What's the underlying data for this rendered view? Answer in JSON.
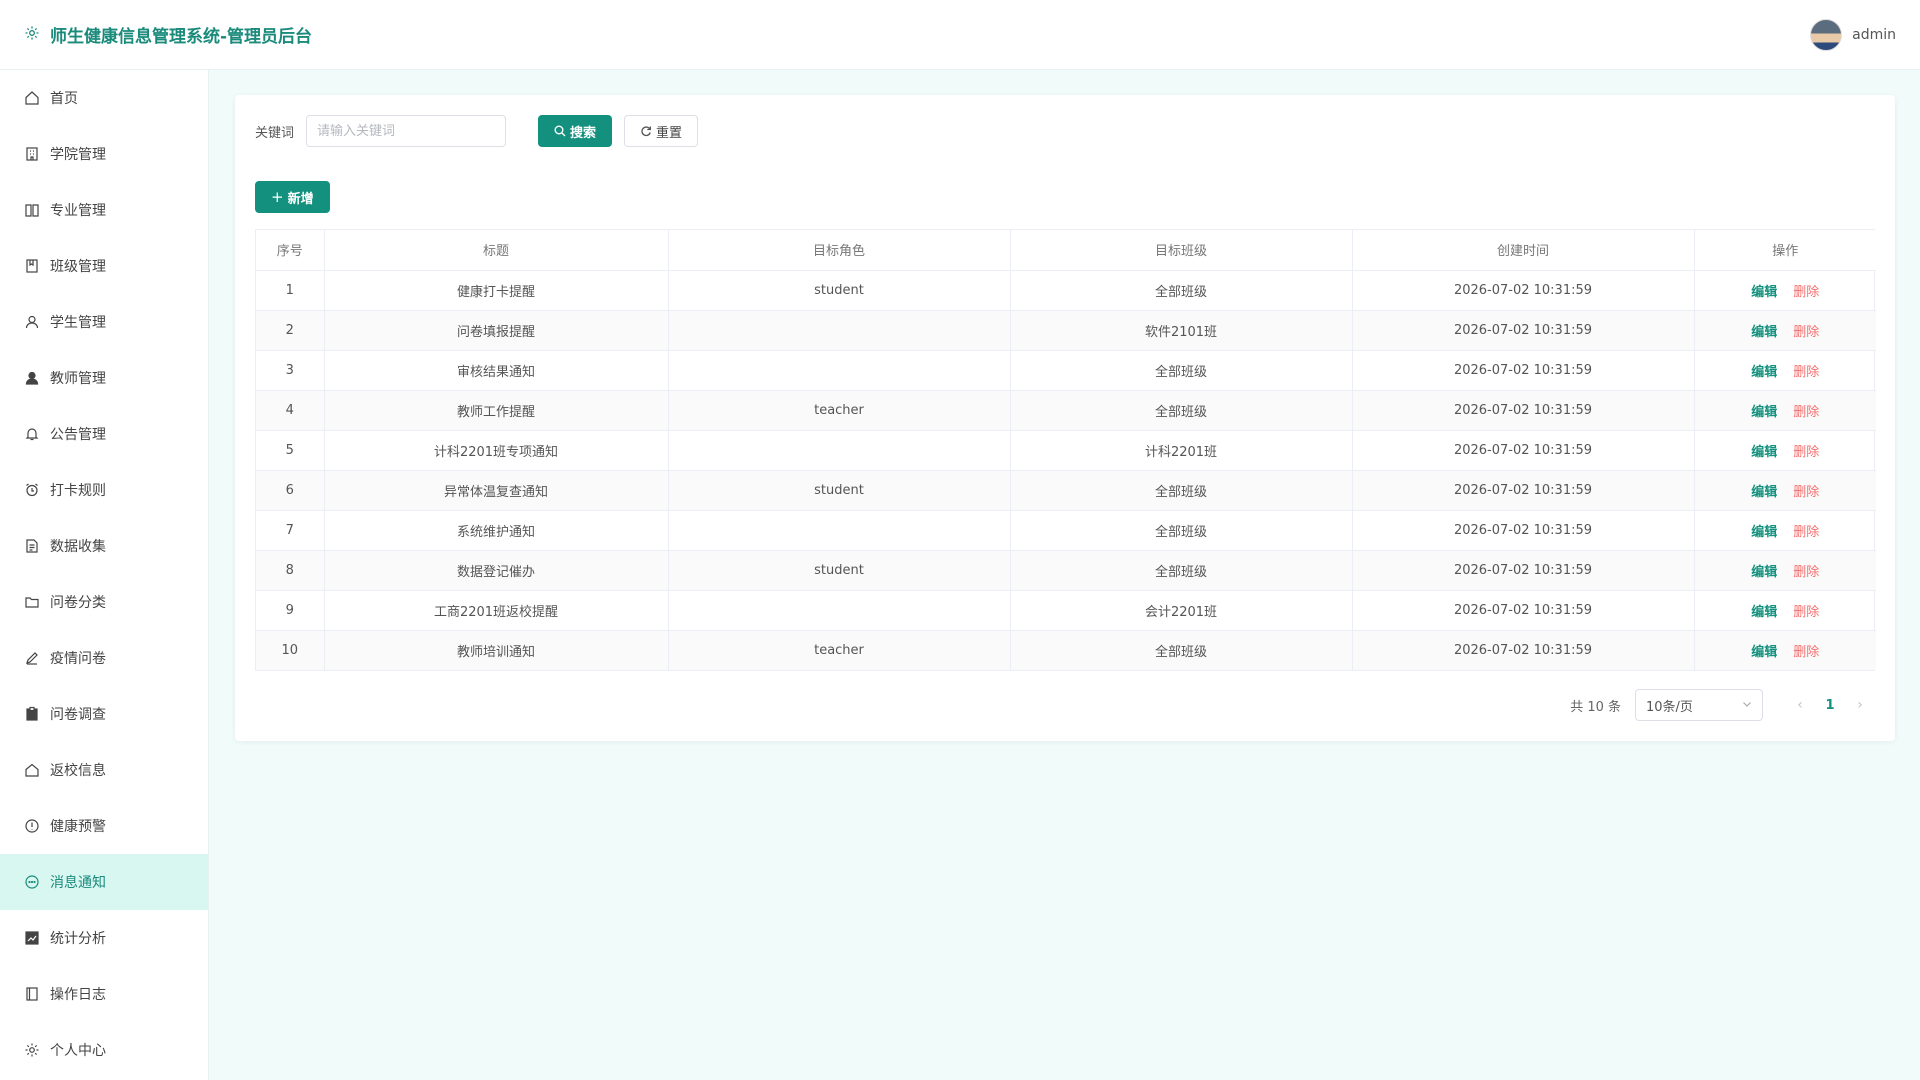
{
  "header": {
    "title": "师生健康信息管理系统-管理员后台",
    "brand_icon": "gear-icon",
    "user_name": "admin",
    "accent": "#1a8a7b"
  },
  "sidebar": {
    "items": [
      {
        "label": "首页",
        "icon": "home-icon",
        "active": false
      },
      {
        "label": "学院管理",
        "icon": "building-icon",
        "active": false
      },
      {
        "label": "专业管理",
        "icon": "book-icon",
        "active": false
      },
      {
        "label": "班级管理",
        "icon": "notebook-icon",
        "active": false
      },
      {
        "label": "学生管理",
        "icon": "user-icon",
        "active": false
      },
      {
        "label": "教师管理",
        "icon": "user-filled-icon",
        "active": false
      },
      {
        "label": "公告管理",
        "icon": "bell-icon",
        "active": false
      },
      {
        "label": "打卡规则",
        "icon": "alarm-clock-icon",
        "active": false
      },
      {
        "label": "数据收集",
        "icon": "document-icon",
        "active": false
      },
      {
        "label": "问卷分类",
        "icon": "folder-icon",
        "active": false
      },
      {
        "label": "疫情问卷",
        "icon": "edit-pen-icon",
        "active": false
      },
      {
        "label": "问卷调查",
        "icon": "clipboard-icon",
        "active": false
      },
      {
        "label": "返校信息",
        "icon": "house-icon",
        "active": false
      },
      {
        "label": "健康预警",
        "icon": "warning-icon",
        "active": false
      },
      {
        "label": "消息通知",
        "icon": "chat-dots-icon",
        "active": true
      },
      {
        "label": "统计分析",
        "icon": "chart-icon",
        "active": false
      },
      {
        "label": "操作日志",
        "icon": "notebook-log-icon",
        "active": false
      },
      {
        "label": "个人中心",
        "icon": "settings-icon",
        "active": false
      }
    ]
  },
  "search": {
    "label": "关键词",
    "placeholder": "请输入关键词",
    "value": "",
    "search_label": "搜索",
    "reset_label": "重置"
  },
  "toolbar": {
    "add_label": "新增"
  },
  "table": {
    "columns": [
      "序号",
      "标题",
      "目标角色",
      "目标班级",
      "创建时间",
      "操作"
    ],
    "edit_label": "编辑",
    "delete_label": "删除",
    "rows": [
      {
        "no": "1",
        "title": "健康打卡提醒",
        "role": "student",
        "class": "全部班级",
        "time": "2026-07-02 10:31:59"
      },
      {
        "no": "2",
        "title": "问卷填报提醒",
        "role": "",
        "class": "软件2101班",
        "time": "2026-07-02 10:31:59"
      },
      {
        "no": "3",
        "title": "审核结果通知",
        "role": "",
        "class": "全部班级",
        "time": "2026-07-02 10:31:59"
      },
      {
        "no": "4",
        "title": "教师工作提醒",
        "role": "teacher",
        "class": "全部班级",
        "time": "2026-07-02 10:31:59"
      },
      {
        "no": "5",
        "title": "计科2201班专项通知",
        "role": "",
        "class": "计科2201班",
        "time": "2026-07-02 10:31:59"
      },
      {
        "no": "6",
        "title": "异常体温复查通知",
        "role": "student",
        "class": "全部班级",
        "time": "2026-07-02 10:31:59"
      },
      {
        "no": "7",
        "title": "系统维护通知",
        "role": "",
        "class": "全部班级",
        "time": "2026-07-02 10:31:59"
      },
      {
        "no": "8",
        "title": "数据登记催办",
        "role": "student",
        "class": "全部班级",
        "time": "2026-07-02 10:31:59"
      },
      {
        "no": "9",
        "title": "工商2201班返校提醒",
        "role": "",
        "class": "会计2201班",
        "time": "2026-07-02 10:31:59"
      },
      {
        "no": "10",
        "title": "教师培训通知",
        "role": "teacher",
        "class": "全部班级",
        "time": "2026-07-02 10:31:59"
      }
    ]
  },
  "pagination": {
    "total_text": "共 10 条",
    "page_size": "10条/页",
    "current_page": "1"
  }
}
